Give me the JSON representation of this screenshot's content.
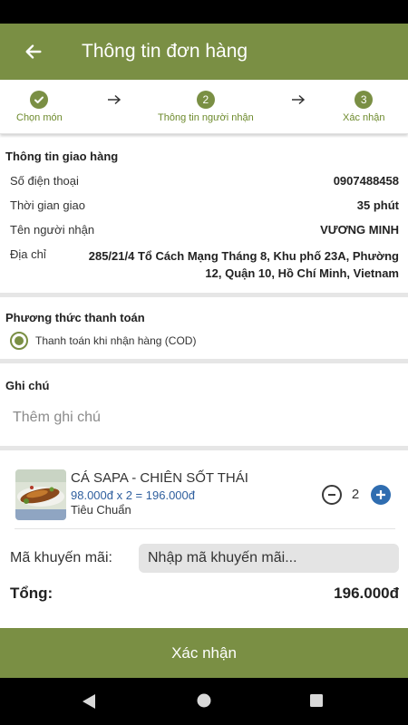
{
  "header": {
    "title": "Thông tin đơn hàng"
  },
  "steps": [
    {
      "label": "Chọn món",
      "marker": "✓"
    },
    {
      "label": "Thông tin người nhận",
      "marker": "2"
    },
    {
      "label": "Xác nhận",
      "marker": "3"
    }
  ],
  "delivery": {
    "title": "Thông tin giao hàng",
    "phone_label": "Số điện thoại",
    "phone": "0907488458",
    "time_label": "Thời gian giao",
    "time": "35 phút",
    "name_label": "Tên người nhận",
    "name": "VƯƠNG MINH",
    "address_label": "Địa chỉ",
    "address_line1": "285/21/4 Tổ Cách Mạng Tháng 8, Khu phố 23A, Phường",
    "address_line2": "12, Quận 10, Hồ Chí Minh, Vietnam"
  },
  "payment": {
    "title": "Phương thức thanh toán",
    "option": "Thanh toán khi nhận hàng (COD)"
  },
  "note": {
    "title": "Ghi chú",
    "placeholder": "Thêm ghi chú"
  },
  "item": {
    "name": "CÁ SAPA - CHIÊN SỐT THÁI",
    "price_line": "98.000đ x 2 = 196.000đ",
    "variant": "Tiêu Chuẩn",
    "quantity": "2"
  },
  "promo": {
    "label": "Mã khuyến mãi:",
    "placeholder": "Nhập mã khuyến mãi..."
  },
  "total": {
    "label": "Tổng:",
    "value": "196.000đ"
  },
  "confirm": {
    "label": "Xác nhận"
  },
  "colors": {
    "brand": "#7a8f44",
    "step_text": "#6d8a2c",
    "price": "#2f5f9e",
    "plus": "#2f6db0"
  },
  "icons": {
    "back": "arrow-left-icon",
    "minus": "minus-circle-icon",
    "plus": "plus-circle-icon"
  }
}
